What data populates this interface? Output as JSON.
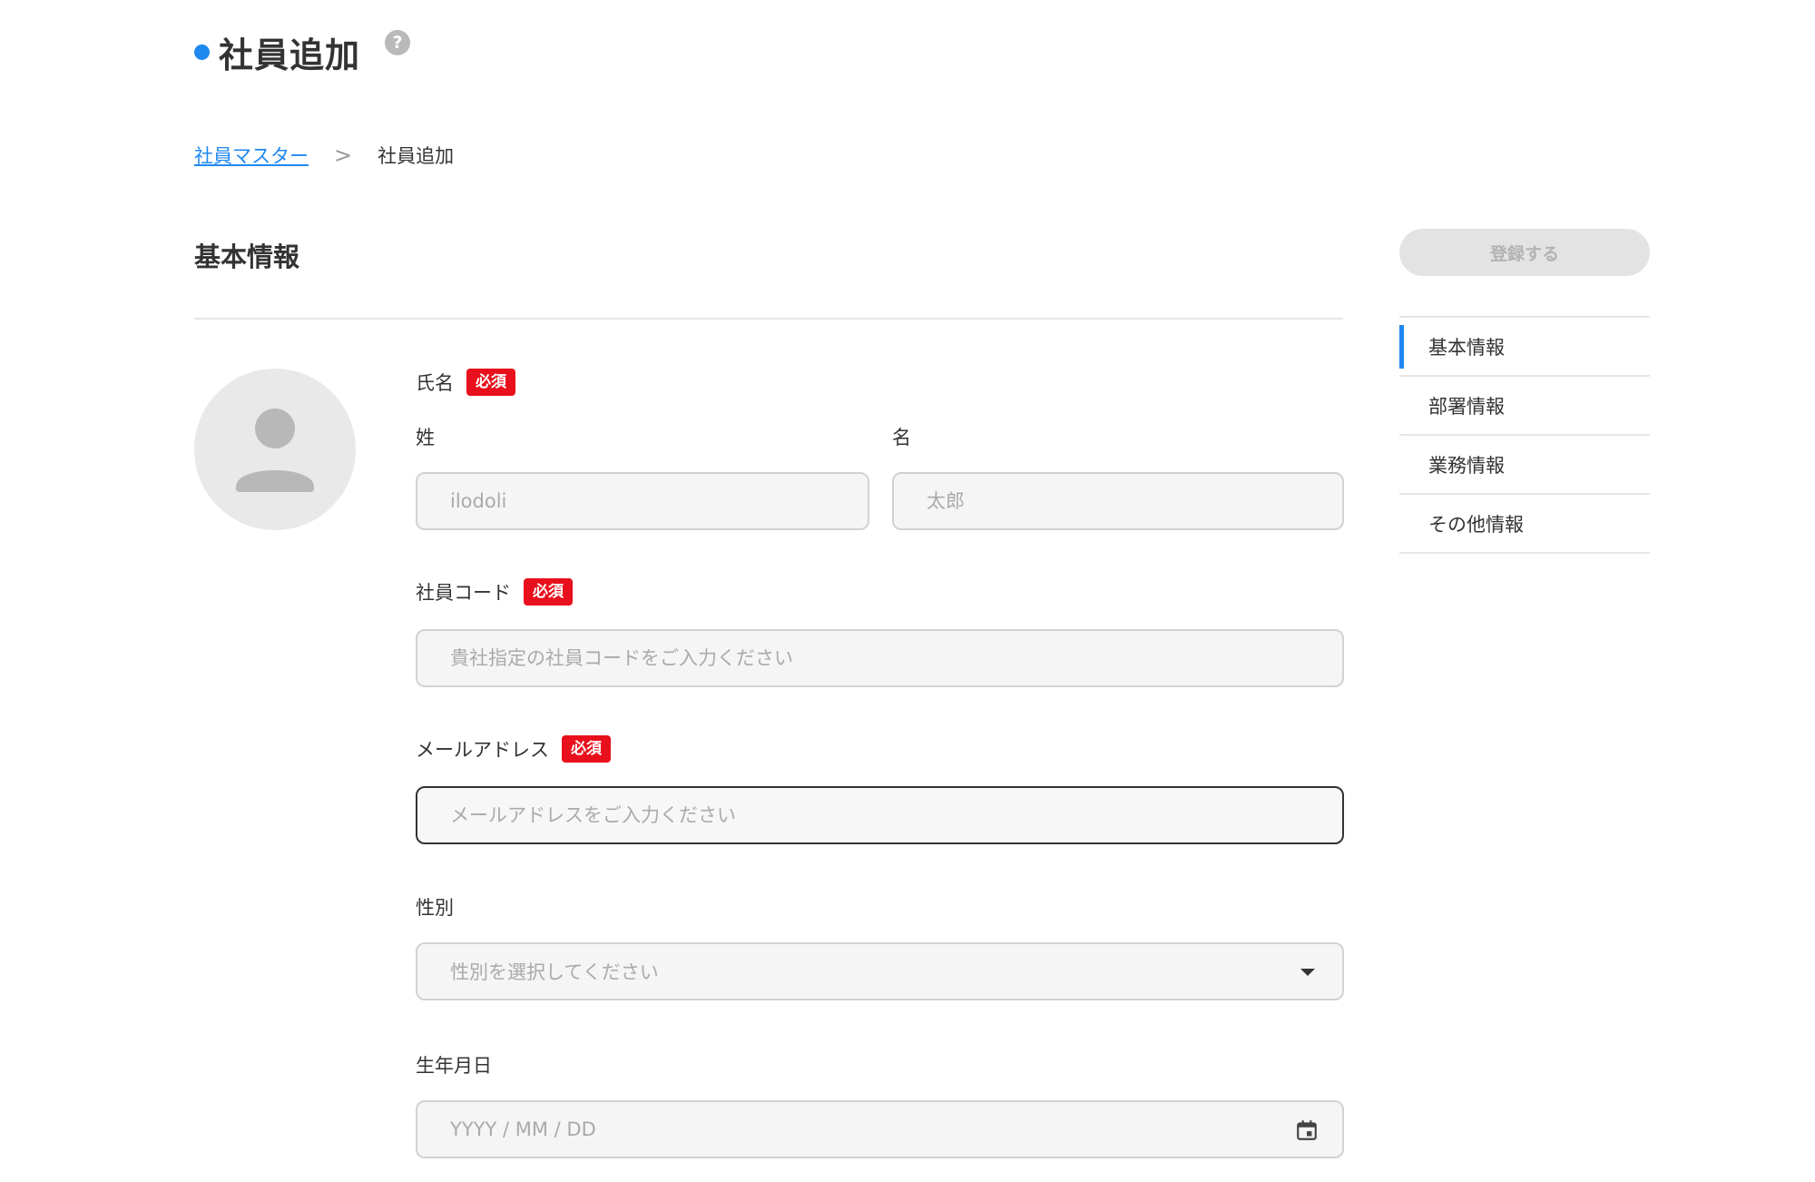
{
  "header": {
    "title": "社員追加",
    "help_icon": "question-circle-icon",
    "accent_color": "#1e88f0"
  },
  "breadcrumb": {
    "parent": "社員マスター",
    "separator": ">",
    "current": "社員追加"
  },
  "section": {
    "title": "基本情報"
  },
  "actions": {
    "register_label": "登録する"
  },
  "side_nav": {
    "items": [
      {
        "label": "基本情報",
        "active": true
      },
      {
        "label": "部署情報",
        "active": false
      },
      {
        "label": "業務情報",
        "active": false
      },
      {
        "label": "その他情報",
        "active": false
      }
    ]
  },
  "form": {
    "required_badge": "必須",
    "name": {
      "label": "氏名",
      "last_label": "姓",
      "last_placeholder": "ilodoli",
      "first_label": "名",
      "first_placeholder": "太郎"
    },
    "employee_code": {
      "label": "社員コード",
      "placeholder": "貴社指定の社員コードをご入力ください"
    },
    "email": {
      "label": "メールアドレス",
      "placeholder": "メールアドレスをご入力ください"
    },
    "gender": {
      "label": "性別",
      "placeholder": "性別を選択してください"
    },
    "birthdate": {
      "label": "生年月日",
      "placeholder": "YYYY / MM / DD"
    }
  }
}
